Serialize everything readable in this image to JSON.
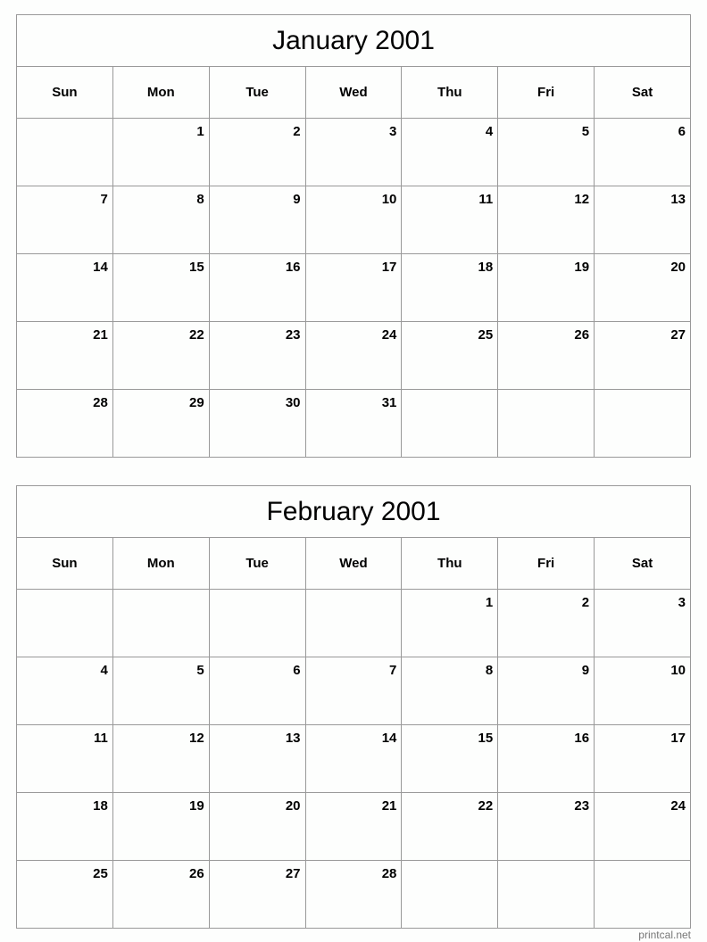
{
  "calendars": [
    {
      "title": "January 2001",
      "days_of_week": [
        "Sun",
        "Mon",
        "Tue",
        "Wed",
        "Thu",
        "Fri",
        "Sat"
      ],
      "weeks": [
        [
          "",
          "1",
          "2",
          "3",
          "4",
          "5",
          "6"
        ],
        [
          "7",
          "8",
          "9",
          "10",
          "11",
          "12",
          "13"
        ],
        [
          "14",
          "15",
          "16",
          "17",
          "18",
          "19",
          "20"
        ],
        [
          "21",
          "22",
          "23",
          "24",
          "25",
          "26",
          "27"
        ],
        [
          "28",
          "29",
          "30",
          "31",
          "",
          "",
          ""
        ]
      ]
    },
    {
      "title": "February 2001",
      "days_of_week": [
        "Sun",
        "Mon",
        "Tue",
        "Wed",
        "Thu",
        "Fri",
        "Sat"
      ],
      "weeks": [
        [
          "",
          "",
          "",
          "",
          "1",
          "2",
          "3"
        ],
        [
          "4",
          "5",
          "6",
          "7",
          "8",
          "9",
          "10"
        ],
        [
          "11",
          "12",
          "13",
          "14",
          "15",
          "16",
          "17"
        ],
        [
          "18",
          "19",
          "20",
          "21",
          "22",
          "23",
          "24"
        ],
        [
          "25",
          "26",
          "27",
          "28",
          "",
          "",
          ""
        ]
      ]
    }
  ],
  "footer": "printcal.net",
  "colors": {
    "grid": "#999999",
    "text": "#000000",
    "footer": "#777777"
  }
}
